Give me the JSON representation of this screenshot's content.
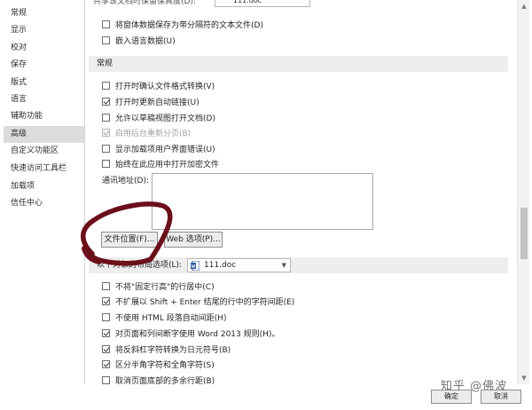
{
  "sidebar": {
    "items": [
      {
        "label": "常规"
      },
      {
        "label": "显示"
      },
      {
        "label": "校对"
      },
      {
        "label": "保存"
      },
      {
        "label": "版式"
      },
      {
        "label": "语言"
      },
      {
        "label": "辅助功能"
      },
      {
        "label": "高级",
        "active": true
      },
      {
        "label": "自定义功能区"
      },
      {
        "label": "快速访问工具栏"
      },
      {
        "label": "加载项"
      },
      {
        "label": "信任中心"
      }
    ]
  },
  "top_cut": {
    "label": "共享该文档时保留保真度(D):",
    "doc_value": "111.doc"
  },
  "save_options": {
    "items": [
      {
        "label": "将窗体数据保存为带分隔符的文本文件(D)",
        "checked": false,
        "disabled": false
      },
      {
        "label": "嵌入语言数据(U)",
        "checked": false,
        "disabled": false
      }
    ]
  },
  "general": {
    "header": "常规",
    "items": [
      {
        "label": "打开时确认文件格式转换(V)",
        "checked": false,
        "disabled": false
      },
      {
        "label": "打开时更新自动链接(U)",
        "checked": true,
        "disabled": false
      },
      {
        "label": "允许以草稿视图打开文档(D)",
        "checked": false,
        "disabled": false
      },
      {
        "label": "启用后台重新分页(B)",
        "checked": true,
        "disabled": true
      },
      {
        "label": "显示加载项用户界面错误(U)",
        "checked": false,
        "disabled": false
      },
      {
        "label": "始终在此应用中打开加密文件",
        "checked": false,
        "disabled": false
      }
    ],
    "address_label": "通讯地址(D):",
    "address_value": "",
    "file_locations_button": "文件位置(F)...",
    "web_options_button": "Web 选项(P)..."
  },
  "layout": {
    "header": "以下对象的布局选项(L):",
    "doc_value": "111.doc",
    "items": [
      {
        "label": "不将\"固定行高\"的行居中(C)",
        "checked": false
      },
      {
        "label": "不扩展以 Shift + Enter 结尾的行中的字符间距(E)",
        "checked": true
      },
      {
        "label": "不使用 HTML 段落自动间距(H)",
        "checked": false
      },
      {
        "label": "对页面和列间断字使用 Word 2013 规则(H)。",
        "checked": true
      },
      {
        "label": "将反斜杠字符转换为日元符号(B)",
        "checked": true
      },
      {
        "label": "区分半角字符和全角字符(S)",
        "checked": true
      },
      {
        "label": "取消页面底部的多余行距(B)",
        "checked": false
      }
    ]
  },
  "footer": {
    "ok": "确定",
    "cancel": "取消",
    "watermark": "知乎 @佛波"
  },
  "colors": {
    "active_item": "#dcdcdc",
    "section_bg": "#eeeeee",
    "annotation": "#6b0f1a"
  },
  "icons": {
    "doc": "word-doc-icon",
    "dropdown": "chevron-down-icon"
  }
}
